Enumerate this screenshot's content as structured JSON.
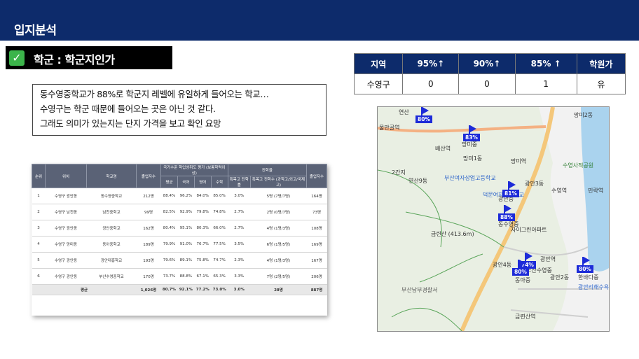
{
  "header": {
    "title": "입지분석"
  },
  "section": {
    "check": "✓",
    "title": "학군 : 학군지인가"
  },
  "note": {
    "lines": [
      "동수영중학교가 88%로 학군지 레벨에 유일하게 들어오는 학교…",
      "수영구는 학군 때문에 들어오는 곳은 아닌 것 같다.",
      "그래도 의미가 있는지는 단지 가격을 보고 확인 요망"
    ]
  },
  "summary": {
    "headers": [
      "지역",
      "95%↑",
      "90%↑",
      "85% ↑",
      "학원가"
    ],
    "row": [
      "수영구",
      "0",
      "0",
      "1",
      "유"
    ]
  },
  "school_table": {
    "headers_top": [
      "순위",
      "위치",
      "학교명",
      "졸업자수",
      "국가수준 학업성취도 평가 (보통학력이상)",
      "진학율",
      "졸업자수"
    ],
    "headers_sub": [
      "평균",
      "국어",
      "영어",
      "수학",
      "특목고 진학률",
      "특목고 진학수 (과학고/외고/국제고)"
    ],
    "rows": [
      [
        "1",
        "수영구 광안동",
        "동수영중학교",
        "212명",
        "88.4%",
        "96.2%",
        "84.0%",
        "85.0%",
        "3.0%",
        "5명 (7명/7명)",
        "164명"
      ],
      [
        "2",
        "수영구 남천동",
        "남천중학교",
        "99명",
        "82.5%",
        "92.9%",
        "79.8%",
        "74.8%",
        "2.7%",
        "2명 (0명/7명)",
        "73명"
      ],
      [
        "3",
        "수영구 광안동",
        "광안중학교",
        "162명",
        "80.4%",
        "95.1%",
        "80.3%",
        "66.0%",
        "2.7%",
        "4명 (1명/3명)",
        "108명"
      ],
      [
        "4",
        "수영구 망미동",
        "동아중학교",
        "189명",
        "79.9%",
        "91.0%",
        "76.7%",
        "77.5%",
        "3.5%",
        "6명 (1명/5명)",
        "169명"
      ],
      [
        "5",
        "수영구 광안동",
        "광안대흥학교",
        "193명",
        "79.6%",
        "89.1%",
        "75.8%",
        "74.7%",
        "2.3%",
        "4명 (1명/3명)",
        "167명"
      ],
      [
        "6",
        "수영구 광안동",
        "부산수영중학교",
        "170명",
        "73.7%",
        "88.8%",
        "67.1%",
        "65.3%",
        "3.3%",
        "7명 (2명/5명)",
        "206명"
      ]
    ],
    "avg": [
      "평균",
      "1,026명",
      "80.7%",
      "92.1%",
      "77.2%",
      "73.0%",
      "3.0%",
      "28명",
      "887명"
    ]
  },
  "map": {
    "labels": [
      "연산",
      "물만골역",
      "연제중",
      "배산역",
      "망미중",
      "망미1동",
      "망미역",
      "연산9동",
      "2간지",
      "부산여자상업고등학교",
      "덕문여자고등학교",
      "광안중",
      "광안3동",
      "수영역",
      "수영사적공원",
      "민락역",
      "동수영중",
      "금련산 (413.6m)",
      "광안4동",
      "광안역",
      "부산수영중",
      "동아중",
      "광안2동",
      "한바다중",
      "금련산역",
      "부산남부경찰서",
      "광안리해수욕장",
      "망미2동",
      "자이그린아파트"
    ],
    "flags": [
      "80%",
      "83%",
      "81%",
      "88%",
      "74%",
      "80%",
      "80%"
    ]
  }
}
